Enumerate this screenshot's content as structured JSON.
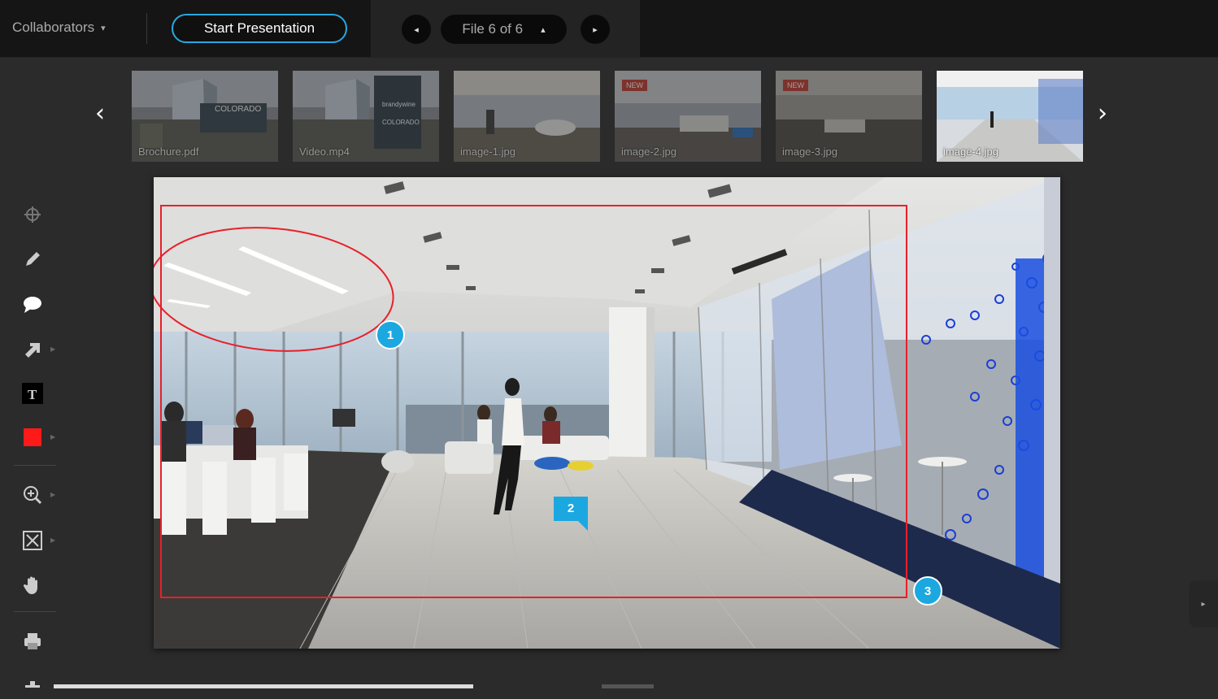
{
  "header": {
    "collaborators_label": "Collaborators",
    "start_presentation_label": "Start Presentation",
    "file_indicator": "File 6 of 6",
    "prev_symbol": "◂",
    "next_symbol": "▸",
    "up_symbol": "▴",
    "caret_symbol": "▾"
  },
  "thumbnails": [
    {
      "label": "Brochure.pdf",
      "badge": ""
    },
    {
      "label": "Video.mp4",
      "badge": ""
    },
    {
      "label": "image-1.jpg",
      "badge": ""
    },
    {
      "label": "image-2.jpg",
      "badge": "NEW"
    },
    {
      "label": "image-3.jpg",
      "badge": "NEW"
    },
    {
      "label": "image-4.jpg",
      "badge": ""
    }
  ],
  "thumb_text": {
    "brochure_sign": "COLORADO",
    "video_sign": "COLORADO",
    "video_brand": "brandywine"
  },
  "annotations": {
    "marker1": "1",
    "marker2": "2",
    "marker3": "3"
  },
  "tools": [
    "crosshair-icon",
    "pencil-icon",
    "comment-icon",
    "arrow-icon",
    "text-icon",
    "color-icon",
    "zoom-in-icon",
    "fit-icon",
    "hand-icon",
    "print-icon"
  ],
  "colors": {
    "accent": "#29a8e0",
    "annotation_red": "#e8202a",
    "marker_blue": "#1ba8e0",
    "active_color_swatch": "#ff1a1a"
  }
}
